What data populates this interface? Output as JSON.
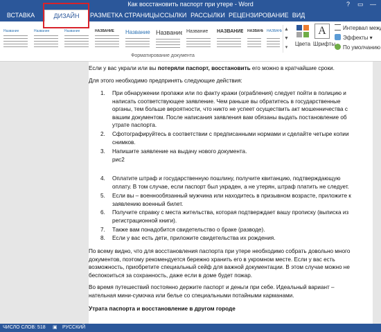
{
  "window": {
    "title": "Как восстановить паспорт при утере - Word",
    "controls": [
      "?",
      "▭",
      "—"
    ]
  },
  "tabs": [
    {
      "label": "ВСТАВКА"
    },
    {
      "label": "ДИЗАЙН",
      "active": true
    },
    {
      "label": "РАЗМЕТКА СТРАНИЦЫ"
    },
    {
      "label": "ССЫЛКИ"
    },
    {
      "label": "РАССЫЛКИ"
    },
    {
      "label": "РЕЦЕНЗИРОВАНИЕ"
    },
    {
      "label": "ВИД"
    }
  ],
  "ribbon": {
    "styles": [
      {
        "label": "Название"
      },
      {
        "label": "Название"
      },
      {
        "label": "Название"
      },
      {
        "label": "НАЗВАНИЕ"
      },
      {
        "label": "Название"
      },
      {
        "label": "Название"
      },
      {
        "label": "Название"
      },
      {
        "label": "НАЗВАНИЕ"
      },
      {
        "label": "НАЗВАНИЕ"
      },
      {
        "label": "НАЗВАНИЕ"
      }
    ],
    "group_label": "Форматирование документа",
    "colors_label": "Цвета",
    "fonts_label": "Шрифты",
    "fonts_glyph": "A",
    "paragraph_spacing": "Интервал между",
    "effects": "Эффекты",
    "set_default": "По умолчанию",
    "colors_accent": "#2b579a"
  },
  "document": {
    "intro_pre": "Если у вас украли или вы ",
    "intro_bold": "потеряли паспорт, восстановить",
    "intro_post": " его можно в кратчайшие сроки.",
    "intro2": "Для этого необходимо предпринять следующие действия:",
    "list1": [
      {
        "n": "1.",
        "lines": [
          "При обнаружении пропажи или по факту кражи (ограбления) следует пойти в полицию и",
          "написать соответствующее заявление. Чем раньше вы обратитесь в государственные",
          "органы, тем больше вероятности, что никто не успеет осуществить акт мошенничества с",
          "вашим документом. После написания заявления вам обязаны выдать постановление об",
          "утрате паспорта."
        ]
      },
      {
        "n": "2.",
        "lines": [
          "Сфотографируйтесь в соответствии с предписанными нормами и сделайте четыре копии",
          "снимков."
        ]
      },
      {
        "n": "3.",
        "lines": [
          "Напишите заявление на выдачу нового документа.",
          "рис2"
        ]
      }
    ],
    "list2": [
      {
        "n": "4.",
        "lines": [
          "Оплатите штраф и государственную пошлину, получите квитанцию, подтверждающую",
          "оплату. В том случае, если паспорт был украден, а не утерян, штраф платить не следует."
        ]
      },
      {
        "n": "5.",
        "lines": [
          "Если вы – военнообязанный мужчина или находитесь в призывном возрасте, приложите к",
          "заявлению военный билет."
        ]
      },
      {
        "n": "6.",
        "lines": [
          "Получите справку с места жительства, которая подтверждает вашу прописку (выписка из",
          "регистрационной книги)."
        ]
      },
      {
        "n": "7.",
        "lines": [
          "Также вам понадобится свидетельство о браке (разводе)."
        ]
      },
      {
        "n": "8.",
        "lines": [
          "Если у вас есть дети, приложите свидетельства их рождения."
        ]
      }
    ],
    "para1": [
      "По всему видно, что для восстановления паспорта при утере необходимо собрать довольно много",
      "документов, поэтому рекомендуется бережно хранить его в укромном месте. Если у вас есть",
      "возможность, приобретите специальный сейф для важной документации. В этом случае можно не",
      "беспокоиться за сохранность, даже если в доме будет пожар."
    ],
    "para2": [
      "Во время путешествий постоянно держите паспорт и деньги при себе. Идеальный вариант –",
      "нательная мини-сумочка или белье со специальными потайными карманами."
    ],
    "heading": "Утрата паспорта и восстановление в другом городе"
  },
  "status": {
    "words": "ЧИСЛО СЛОВ: 518",
    "language": "РУССКИЙ"
  }
}
